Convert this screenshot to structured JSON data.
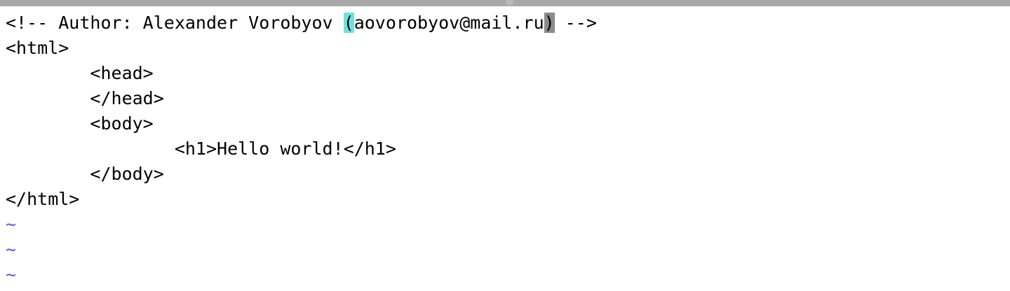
{
  "editor": {
    "lines": [
      {
        "parts": [
          "<!-- Author: Alexander Vorobyov ",
          "(",
          "aovorobyov@mail.ru",
          ")",
          " -->"
        ]
      },
      {
        "text": "<html>"
      },
      {
        "text": "        <head>"
      },
      {
        "text": "        </head>"
      },
      {
        "text": "        <body>"
      },
      {
        "text": "                <h1>Hello world!</h1>"
      },
      {
        "text": "        </body>"
      },
      {
        "text": "</html>"
      }
    ],
    "empty_line_marker": "~",
    "colors": {
      "tilde": "#5a52f0",
      "match_paren_highlight": "#6fe0e0",
      "cursor_block": "#8a8a8a",
      "text": "#000000",
      "background": "#ffffff"
    }
  }
}
